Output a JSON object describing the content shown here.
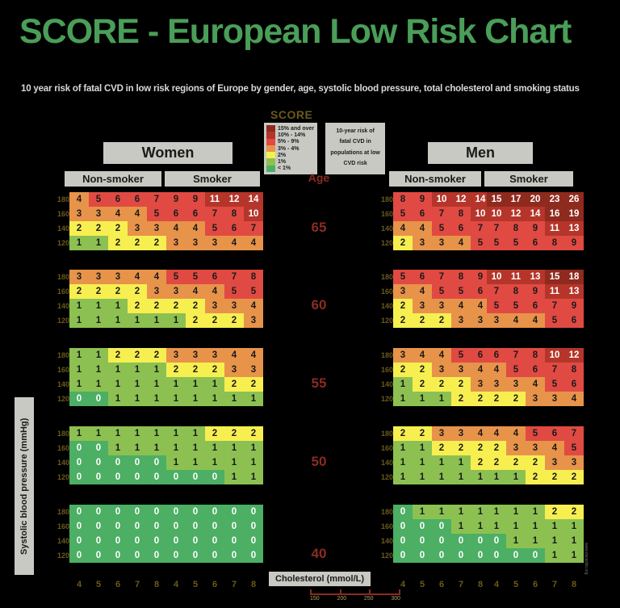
{
  "title": "SCORE - European Low Risk Chart",
  "subtitle": "10 year risk of fatal CVD in low risk regions of Europe by gender, age, systolic blood pressure, total cholesterol and smoking status",
  "legend": {
    "title": "SCORE",
    "note": "10-year risk of fatal CVD in populations at low CVD risk",
    "rows": [
      {
        "label": "15% and over",
        "color": "#8f2a1e"
      },
      {
        "label": "10% - 14%",
        "color": "#b5352a"
      },
      {
        "label": "5% - 9%",
        "color": "#e04a43"
      },
      {
        "label": "3% - 4%",
        "color": "#e8934a"
      },
      {
        "label": "2%",
        "color": "#f7ef50"
      },
      {
        "label": "1%",
        "color": "#8cc152"
      },
      {
        "label": "< 1%",
        "color": "#4caf63"
      }
    ]
  },
  "axes": {
    "sbp_title": "Systolic blood pressure (mmHg)",
    "sbp_ticks": [
      "180",
      "160",
      "140",
      "120"
    ],
    "chol_title": "Cholesterol (mmol/L)",
    "chol_ticks": [
      "4",
      "5",
      "6",
      "7",
      "8"
    ],
    "chol_mgdl_ticks": [
      "150",
      "200",
      "250",
      "300"
    ]
  },
  "columns": {
    "women": "Women",
    "men": "Men",
    "non_smoker": "Non-smoker",
    "smoker": "Smoker",
    "age_title": "Age"
  },
  "ages": [
    "65",
    "60",
    "55",
    "50",
    "40"
  ],
  "watermark": "www.escardio.org",
  "chart_data": {
    "type": "heatmap",
    "title": "SCORE - European Low Risk Chart",
    "xlabel": "Cholesterol (mmol/L)",
    "ylabel": "Systolic blood pressure (mmHg)",
    "x": [
      "4",
      "5",
      "6",
      "7",
      "8"
    ],
    "y": [
      "180",
      "160",
      "140",
      "120"
    ],
    "legend_position": "top-center",
    "value_unit": "% 10-year risk of fatal CVD",
    "panels": [
      {
        "gender": "Women",
        "smoking": "Non-smoker",
        "age": "65",
        "values": [
          [
            4,
            5,
            6,
            6,
            7
          ],
          [
            3,
            3,
            4,
            4,
            5
          ],
          [
            2,
            2,
            2,
            3,
            3
          ],
          [
            1,
            1,
            2,
            2,
            2
          ]
        ]
      },
      {
        "gender": "Women",
        "smoking": "Smoker",
        "age": "65",
        "values": [
          [
            9,
            9,
            11,
            12,
            14
          ],
          [
            6,
            6,
            7,
            8,
            10
          ],
          [
            4,
            4,
            5,
            6,
            7
          ],
          [
            3,
            3,
            3,
            4,
            4
          ]
        ]
      },
      {
        "gender": "Women",
        "smoking": "Non-smoker",
        "age": "60",
        "values": [
          [
            3,
            3,
            3,
            4,
            4
          ],
          [
            2,
            2,
            2,
            2,
            3
          ],
          [
            1,
            1,
            1,
            2,
            2
          ],
          [
            1,
            1,
            1,
            1,
            1
          ]
        ]
      },
      {
        "gender": "Women",
        "smoking": "Smoker",
        "age": "60",
        "values": [
          [
            5,
            5,
            6,
            7,
            8
          ],
          [
            3,
            4,
            4,
            5,
            5
          ],
          [
            2,
            2,
            3,
            3,
            4
          ],
          [
            1,
            2,
            2,
            2,
            3
          ]
        ]
      },
      {
        "gender": "Women",
        "smoking": "Non-smoker",
        "age": "55",
        "values": [
          [
            1,
            1,
            2,
            2,
            2
          ],
          [
            1,
            1,
            1,
            1,
            1
          ],
          [
            1,
            1,
            1,
            1,
            1
          ],
          [
            0,
            0,
            1,
            1,
            1
          ]
        ]
      },
      {
        "gender": "Women",
        "smoking": "Smoker",
        "age": "55",
        "values": [
          [
            3,
            3,
            3,
            4,
            4
          ],
          [
            2,
            2,
            2,
            3,
            3
          ],
          [
            1,
            1,
            1,
            2,
            2
          ],
          [
            1,
            1,
            1,
            1,
            1
          ]
        ]
      },
      {
        "gender": "Women",
        "smoking": "Non-smoker",
        "age": "50",
        "values": [
          [
            1,
            1,
            1,
            1,
            1
          ],
          [
            0,
            0,
            1,
            1,
            1
          ],
          [
            0,
            0,
            0,
            0,
            0
          ],
          [
            0,
            0,
            0,
            0,
            0
          ]
        ]
      },
      {
        "gender": "Women",
        "smoking": "Smoker",
        "age": "50",
        "values": [
          [
            1,
            1,
            2,
            2,
            2
          ],
          [
            1,
            1,
            1,
            1,
            1
          ],
          [
            1,
            1,
            1,
            1,
            1
          ],
          [
            0,
            0,
            0,
            1,
            1
          ]
        ]
      },
      {
        "gender": "Women",
        "smoking": "Non-smoker",
        "age": "40",
        "values": [
          [
            0,
            0,
            0,
            0,
            0
          ],
          [
            0,
            0,
            0,
            0,
            0
          ],
          [
            0,
            0,
            0,
            0,
            0
          ],
          [
            0,
            0,
            0,
            0,
            0
          ]
        ]
      },
      {
        "gender": "Women",
        "smoking": "Smoker",
        "age": "40",
        "values": [
          [
            0,
            0,
            0,
            0,
            0
          ],
          [
            0,
            0,
            0,
            0,
            0
          ],
          [
            0,
            0,
            0,
            0,
            0
          ],
          [
            0,
            0,
            0,
            0,
            0
          ]
        ]
      },
      {
        "gender": "Men",
        "smoking": "Non-smoker",
        "age": "65",
        "values": [
          [
            8,
            9,
            10,
            12,
            14
          ],
          [
            5,
            6,
            7,
            8,
            10
          ],
          [
            4,
            4,
            5,
            6,
            7
          ],
          [
            2,
            3,
            3,
            4,
            5
          ]
        ]
      },
      {
        "gender": "Men",
        "smoking": "Smoker",
        "age": "65",
        "values": [
          [
            15,
            17,
            20,
            23,
            26
          ],
          [
            10,
            12,
            14,
            16,
            19
          ],
          [
            7,
            8,
            9,
            11,
            13
          ],
          [
            5,
            5,
            6,
            8,
            9
          ]
        ]
      },
      {
        "gender": "Men",
        "smoking": "Non-smoker",
        "age": "60",
        "values": [
          [
            5,
            6,
            7,
            8,
            9
          ],
          [
            3,
            4,
            5,
            5,
            6
          ],
          [
            2,
            3,
            3,
            4,
            4
          ],
          [
            2,
            2,
            2,
            3,
            3
          ]
        ]
      },
      {
        "gender": "Men",
        "smoking": "Smoker",
        "age": "60",
        "values": [
          [
            10,
            11,
            13,
            15,
            18
          ],
          [
            7,
            8,
            9,
            11,
            13
          ],
          [
            5,
            5,
            6,
            7,
            9
          ],
          [
            3,
            4,
            4,
            5,
            6
          ]
        ]
      },
      {
        "gender": "Men",
        "smoking": "Non-smoker",
        "age": "55",
        "values": [
          [
            3,
            4,
            4,
            5,
            6
          ],
          [
            2,
            2,
            3,
            3,
            4
          ],
          [
            1,
            2,
            2,
            2,
            3
          ],
          [
            1,
            1,
            1,
            2,
            2
          ]
        ]
      },
      {
        "gender": "Men",
        "smoking": "Smoker",
        "age": "55",
        "values": [
          [
            6,
            7,
            8,
            10,
            12
          ],
          [
            4,
            5,
            6,
            7,
            8
          ],
          [
            3,
            3,
            4,
            5,
            6
          ],
          [
            2,
            2,
            3,
            3,
            4
          ]
        ]
      },
      {
        "gender": "Men",
        "smoking": "Non-smoker",
        "age": "50",
        "values": [
          [
            2,
            2,
            3,
            3,
            4
          ],
          [
            1,
            1,
            2,
            2,
            2
          ],
          [
            1,
            1,
            1,
            1,
            2
          ],
          [
            1,
            1,
            1,
            1,
            1
          ]
        ]
      },
      {
        "gender": "Men",
        "smoking": "Smoker",
        "age": "50",
        "values": [
          [
            4,
            4,
            5,
            6,
            7
          ],
          [
            2,
            3,
            3,
            4,
            5
          ],
          [
            2,
            2,
            2,
            3,
            3
          ],
          [
            1,
            1,
            2,
            2,
            2
          ]
        ]
      },
      {
        "gender": "Men",
        "smoking": "Non-smoker",
        "age": "40",
        "values": [
          [
            0,
            1,
            1,
            1,
            1
          ],
          [
            0,
            0,
            0,
            1,
            1
          ],
          [
            0,
            0,
            0,
            0,
            0
          ],
          [
            0,
            0,
            0,
            0,
            0
          ]
        ]
      },
      {
        "gender": "Men",
        "smoking": "Smoker",
        "age": "40",
        "values": [
          [
            1,
            1,
            1,
            2,
            2
          ],
          [
            1,
            1,
            1,
            1,
            1
          ],
          [
            0,
            1,
            1,
            1,
            1
          ],
          [
            0,
            0,
            0,
            1,
            1
          ]
        ]
      }
    ]
  }
}
